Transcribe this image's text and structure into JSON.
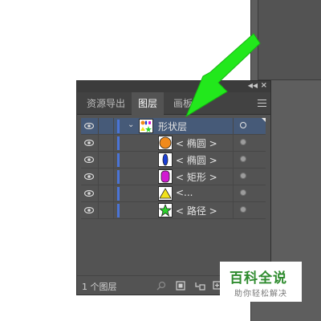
{
  "panel": {
    "tabs": [
      {
        "label": "资源导出",
        "active": false
      },
      {
        "label": "图层",
        "active": true
      },
      {
        "label": "画板",
        "active": false
      }
    ],
    "layers": [
      {
        "name": "形状层",
        "kind": "layer",
        "selected": true,
        "thumb": "multi-shape-thumbnail"
      },
      {
        "name": "< 椭圆 >",
        "kind": "sublayer",
        "thumb": "orange-circle-thumbnail"
      },
      {
        "name": "< 椭圆 >",
        "kind": "sublayer",
        "thumb": "blue-ellipse-thumbnail"
      },
      {
        "name": "< 矩形 >",
        "kind": "sublayer",
        "thumb": "magenta-rounded-rect-thumbnail"
      },
      {
        "name": "<...",
        "kind": "sublayer",
        "thumb": "yellow-triangle-thumbnail"
      },
      {
        "name": "< 路径 >",
        "kind": "sublayer",
        "thumb": "green-star-thumbnail"
      }
    ],
    "footer": {
      "count_label": "1 个图层"
    },
    "colors": {
      "panel_bg": "#535353",
      "selected_row": "#465a78",
      "layer_color": "#4a74d6"
    }
  },
  "watermark": {
    "title": "百科全说",
    "subtitle": "助你轻松解决"
  },
  "annotation": {
    "arrow_color": "#22e81c"
  }
}
